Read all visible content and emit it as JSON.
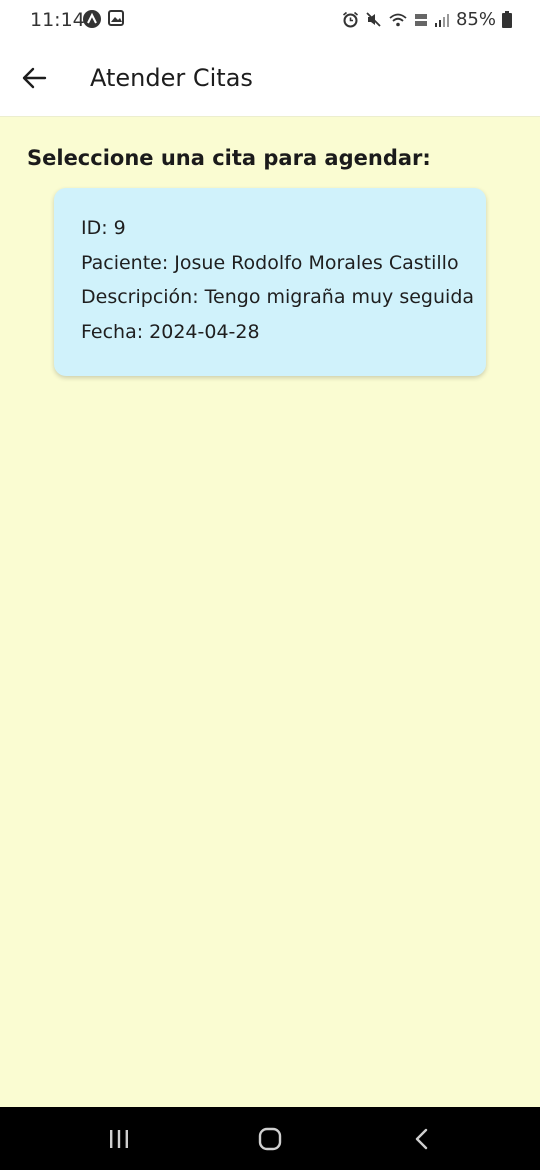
{
  "status_bar": {
    "time": "11:14",
    "battery": "85%"
  },
  "app_bar": {
    "title": "Atender Citas"
  },
  "main": {
    "heading": "Seleccione una cita para agendar:",
    "citas": [
      {
        "id_line": "ID: 9",
        "paciente_line": "Paciente: Josue Rodolfo Morales Castillo",
        "descripcion_line": "Descripción: Tengo migraña muy seguida",
        "fecha_line": "Fecha: 2024-04-28"
      }
    ]
  },
  "colors": {
    "background": "#fafcd2",
    "card": "#d0f2fb",
    "app_bar": "#ffffff",
    "nav_bar": "#000000"
  },
  "icons": {
    "back": "arrow-left-icon",
    "nav_recents": "recents-icon",
    "nav_home": "home-icon",
    "nav_back": "chevron-left-icon"
  }
}
